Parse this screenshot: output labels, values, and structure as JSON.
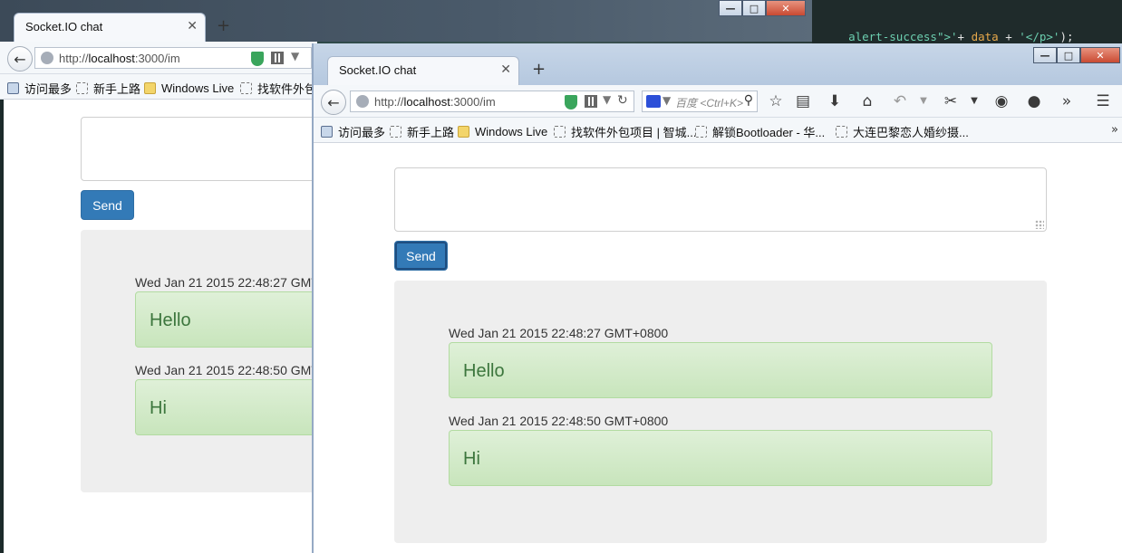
{
  "background_editor": {
    "code": [
      {
        "text": "alert-success\"",
        "kind": "str"
      },
      {
        "text": ">'",
        "kind": "str"
      },
      {
        "text": "+ ",
        "kind": "op"
      },
      {
        "text": "data",
        "kind": "kw"
      },
      {
        "text": " + ",
        "kind": "op"
      },
      {
        "text": "'</p>'",
        "kind": "str"
      },
      {
        "text": ");",
        "kind": "op"
      }
    ]
  },
  "browser": {
    "tab_title": "Socket.IO chat",
    "url_prefix": "http://",
    "url_host": "localhost",
    "url_suffix": ":3000/im",
    "search_placeholder": "百度 <Ctrl+K>",
    "bookmarks": [
      {
        "label": "访问最多",
        "icon": "page"
      },
      {
        "label": "新手上路",
        "icon": "dashed"
      },
      {
        "label": "Windows Live",
        "icon": "folder"
      },
      {
        "label": "找软件外包项目 | 智城...",
        "icon": "dashed"
      },
      {
        "label": "解锁Bootloader - 华...",
        "icon": "dashed"
      },
      {
        "label": "大连巴黎恋人婚纱摄...",
        "icon": "dashed"
      }
    ],
    "back_window_bookmarks": [
      {
        "label": "访问最多",
        "icon": "page"
      },
      {
        "label": "新手上路",
        "icon": "dashed"
      },
      {
        "label": "Windows Live",
        "icon": "folder"
      },
      {
        "label": "找软件外包",
        "icon": "dashed"
      }
    ],
    "toolbar_icons": [
      "bookmark-star-icon",
      "reading-list-icon",
      "download-icon",
      "home-icon",
      "undo-icon",
      "dropdown-icon",
      "screenshot-icon",
      "dropdown-icon",
      "chat-icon",
      "account-icon",
      "overflow-icon",
      "menu-icon"
    ]
  },
  "chat": {
    "send_label": "Send",
    "input_value": "",
    "messages": [
      {
        "time": "Wed Jan 21 2015 22:48:27 GMT+0800",
        "text": "Hello"
      },
      {
        "time": "Wed Jan 21 2015 22:48:50 GMT+0800",
        "text": "Hi"
      }
    ]
  },
  "colors": {
    "send_button": "#337ab7",
    "alert_success_bg": "#dff0d8",
    "alert_success_text": "#3c763d",
    "well_bg": "#eeeeee"
  }
}
